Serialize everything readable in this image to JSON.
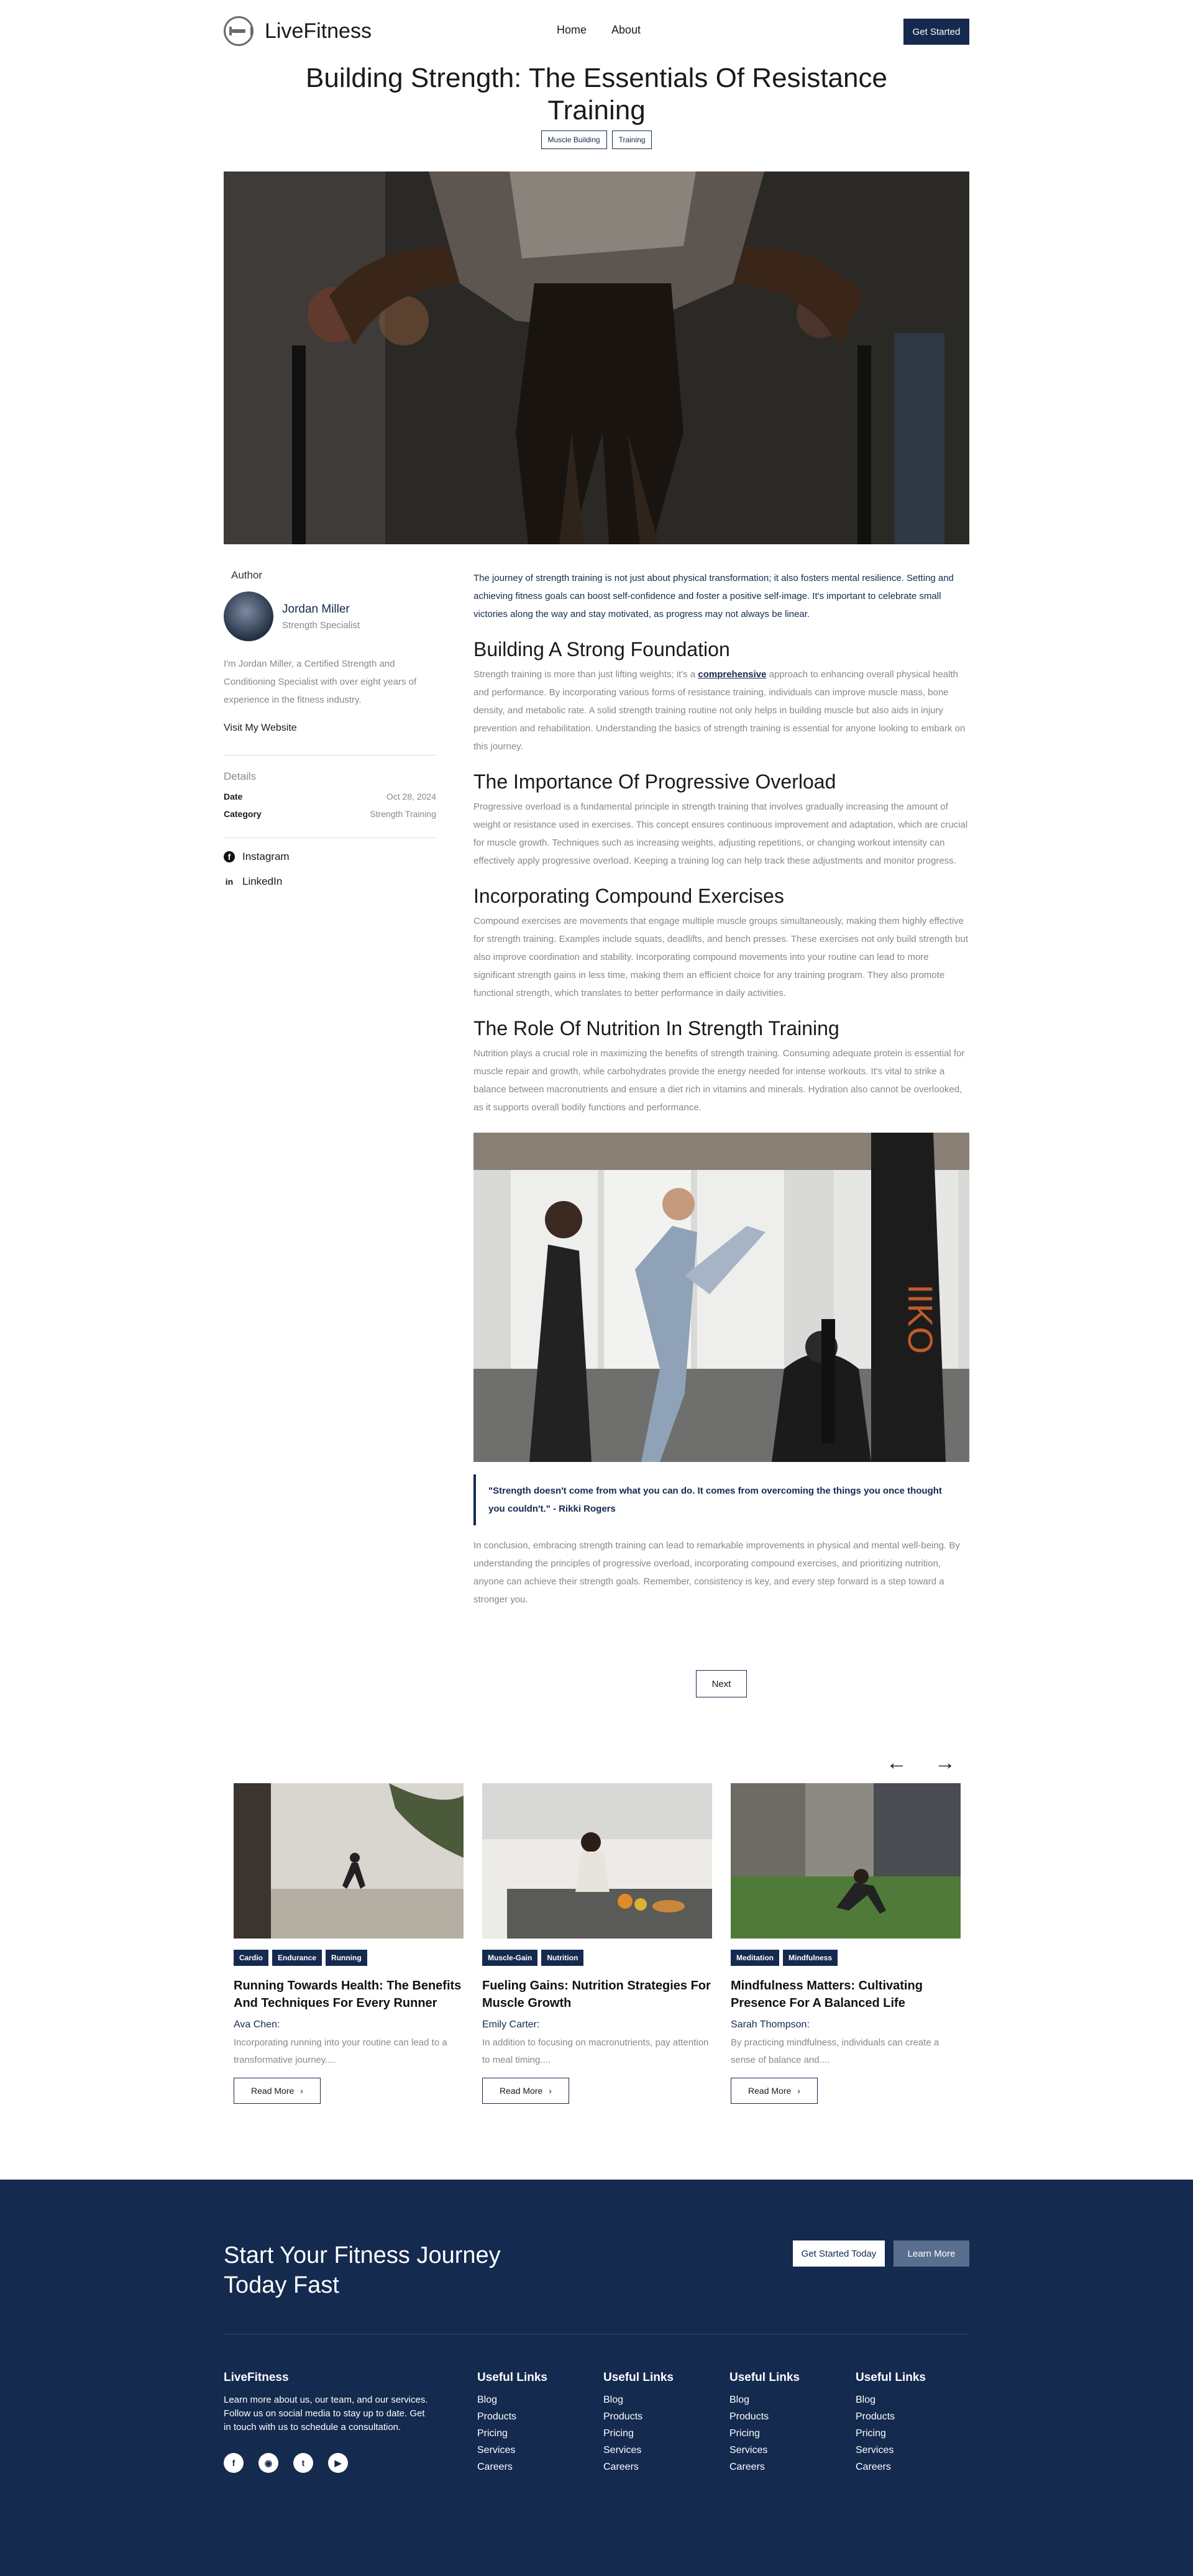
{
  "header": {
    "logo": "LiveFitness",
    "nav": [
      "Home",
      "About"
    ],
    "cta": "Get Started"
  },
  "article": {
    "title": "Building Strength: The Essentials Of Resistance Training",
    "tags": [
      "Muscle Building",
      "Training"
    ],
    "intro": "The journey of strength training is not just about physical transformation; it also fosters mental resilience. Setting and achieving fitness goals can boost self-confidence and foster a positive self-image. It's important to celebrate small victories along the way and stay motivated, as progress may not always be linear.",
    "sections": [
      {
        "heading": "Building A Strong Foundation",
        "pre": "Strength training is more than just lifting weights; it's a ",
        "link": "comprehensive",
        "post": " approach to enhancing overall physical health and performance. By incorporating various forms of resistance training, individuals can improve muscle mass, bone density, and metabolic rate. A solid strength training routine not only helps in building muscle but also aids in injury prevention and rehabilitation. Understanding the basics of strength training is essential for anyone looking to embark on this journey."
      },
      {
        "heading": "The Importance Of Progressive Overload",
        "text": "Progressive overload is a fundamental principle in strength training that involves gradually increasing the amount of weight or resistance used in exercises. This concept ensures continuous improvement and adaptation, which are crucial for muscle growth. Techniques such as increasing weights, adjusting repetitions, or changing workout intensity can effectively apply progressive overload. Keeping a training log can help track these adjustments and monitor progress."
      },
      {
        "heading": "Incorporating Compound Exercises",
        "text": "Compound exercises are movements that engage multiple muscle groups simultaneously, making them highly effective for strength training. Examples include squats, deadlifts, and bench presses. These exercises not only build strength but also improve coordination and stability. Incorporating compound movements into your routine can lead to more significant strength gains in less time, making them an efficient choice for any training program. They also promote functional strength, which translates to better performance in daily activities."
      },
      {
        "heading": "The Role Of Nutrition In Strength Training",
        "text": "Nutrition plays a crucial role in maximizing the benefits of strength training. Consuming adequate protein is essential for muscle repair and growth, while carbohydrates provide the energy needed for intense workouts. It's vital to strike a balance between macronutrients and ensure a diet rich in vitamins and minerals. Hydration also cannot be overlooked, as it supports overall bodily functions and performance."
      }
    ],
    "quote": "\"Strength doesn't come from what you can do. It comes from overcoming the things you once thought you couldn't.\" - Rikki Rogers",
    "conclusion": "In conclusion, embracing strength training can lead to remarkable improvements in physical and mental well-being. By understanding the principles of progressive overload, incorporating compound exercises, and prioritizing nutrition, anyone can achieve their strength goals. Remember, consistency is key, and every step forward is a step toward a stronger you.",
    "next": "Next",
    "punching_bag_text": "IIKO"
  },
  "sidebar": {
    "author_label": "Author",
    "author_name": "Jordan Miller",
    "author_role": "Strength Specialist",
    "bio": "I'm Jordan Miller, a Certified Strength and Conditioning Specialist with over eight years of experience in the fitness industry.",
    "website": "Visit My Website",
    "details_label": "Details",
    "date_label": "Date",
    "date": "Oct 28, 2024",
    "category_label": "Category",
    "category": "Strength Training",
    "socials": [
      "Instagram",
      "LinkedIn"
    ]
  },
  "related": {
    "prev_icon": "arrow-left-icon",
    "next_icon": "arrow-right-icon",
    "cards": [
      {
        "tags": [
          "Cardio",
          "Endurance",
          "Running"
        ],
        "title": "Running Towards Health: The Benefits And Techniques For Every Runner",
        "author": "Ava Chen:",
        "excerpt": "Incorporating running into your routine can lead to a transformative journey....",
        "button": "Read More"
      },
      {
        "tags": [
          "Muscle-Gain",
          "Nutrition"
        ],
        "title": "Fueling Gains: Nutrition Strategies For Muscle Growth",
        "author": "Emily Carter:",
        "excerpt": "In addition to focusing on macronutrients, pay attention to meal timing....",
        "button": "Read More"
      },
      {
        "tags": [
          "Meditation",
          "Mindfulness"
        ],
        "title": "Mindfulness Matters: Cultivating Presence For A Balanced Life",
        "author": "Sarah Thompson:",
        "excerpt": "By practicing mindfulness, individuals can create a sense of balance and....",
        "button": "Read More"
      }
    ]
  },
  "footer": {
    "cta": "Start Your Fitness Journey Today Fast",
    "btn_primary": "Get Started Today",
    "btn_secondary": "Learn More",
    "brand": "LiveFitness",
    "about": "Learn more about us, our team, and our services. Follow us on social media to stay up to date. Get in touch with us to schedule a consultation.",
    "social_icons": [
      "facebook-icon",
      "instagram-icon",
      "twitter-icon",
      "youtube-icon"
    ],
    "columns": [
      {
        "title": "Useful Links",
        "links": [
          "Blog",
          "Products",
          "Pricing",
          "Services",
          "Careers"
        ]
      },
      {
        "title": "Useful Links",
        "links": [
          "Blog",
          "Products",
          "Pricing",
          "Services",
          "Careers"
        ]
      },
      {
        "title": "Useful Links",
        "links": [
          "Blog",
          "Products",
          "Pricing",
          "Services",
          "Careers"
        ]
      },
      {
        "title": "Useful Links",
        "links": [
          "Blog",
          "Products",
          "Pricing",
          "Services",
          "Careers"
        ]
      }
    ]
  },
  "colors": {
    "primary": "#142a4f",
    "muted": "#888888",
    "secondary_button": "#5a6f8f"
  }
}
